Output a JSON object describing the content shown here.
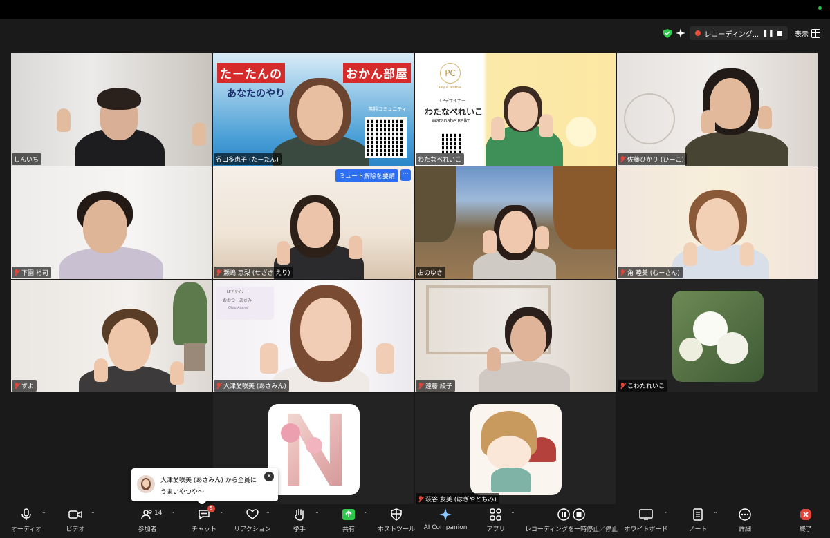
{
  "top_bar": {
    "recording_label": "レコーディング...",
    "view_label": "表示"
  },
  "tiles": [
    {
      "name": "しんいち",
      "muted": false
    },
    {
      "name": "谷口多恵子 (たーたん)",
      "muted": false,
      "banner_title_left": "たーたんの",
      "banner_title_right": "おかん部屋",
      "banner_sub": "あなたのやり　　を支える",
      "banner_note": "無料コミュニティ"
    },
    {
      "name": "わたなべれいこ",
      "muted": false,
      "logo_letters": "PC",
      "logo_sub": "KeyuCreative",
      "header_small": "LPデザイナー",
      "header_big": "わたなべれいこ",
      "header_roman": "Watanabe Reiko"
    },
    {
      "name": "佐藤ひかり (ひーこ)",
      "muted": true
    },
    {
      "name": "下園 裕司",
      "muted": true
    },
    {
      "name": "瀬嶋 恵梨 (せざき えり)",
      "muted": true,
      "unmute_request": "ミュート解除を要請"
    },
    {
      "name": "おのゆき",
      "muted": false
    },
    {
      "name": "角 睦美 (むーさん)",
      "muted": true
    },
    {
      "name": "ずよ",
      "muted": true
    },
    {
      "name": "大津愛咲美 (あさみん)",
      "muted": true,
      "card_line1": "LPデザイナー",
      "card_line2": "おおつ　あさみ",
      "card_line3": "Otsu Asami"
    },
    {
      "name": "遠藤 綾子",
      "muted": true
    },
    {
      "name": "こわたれいこ",
      "muted": true
    },
    {
      "name": "",
      "muted": false
    },
    {
      "name": "萩谷 友美 (はぎやともみ)",
      "muted": true
    }
  ],
  "chat_toast": {
    "from": "大津愛咲美 (あさみん) から全員に",
    "message": "うまいやつや〜"
  },
  "toolbar": {
    "audio": "オーディオ",
    "video": "ビデオ",
    "participants": "参加者",
    "participants_count": "14",
    "chat": "チャット",
    "chat_badge": "5",
    "reactions": "リアクション",
    "raise_hand": "挙手",
    "share": "共有",
    "host_tools": "ホストツール",
    "ai_companion": "AI Companion",
    "apps": "アプリ",
    "recording": "レコーディングを一時停止／停止",
    "whiteboard": "ホワイトボード",
    "notes": "ノート",
    "more": "詳細",
    "end": "終了"
  },
  "colors": {
    "active_speaker_border": "#2ec84b",
    "muted_icon": "#e0463b",
    "accent_blue": "#2d6ff2",
    "share_green": "#2ec84b",
    "end_red": "#e0463b"
  }
}
